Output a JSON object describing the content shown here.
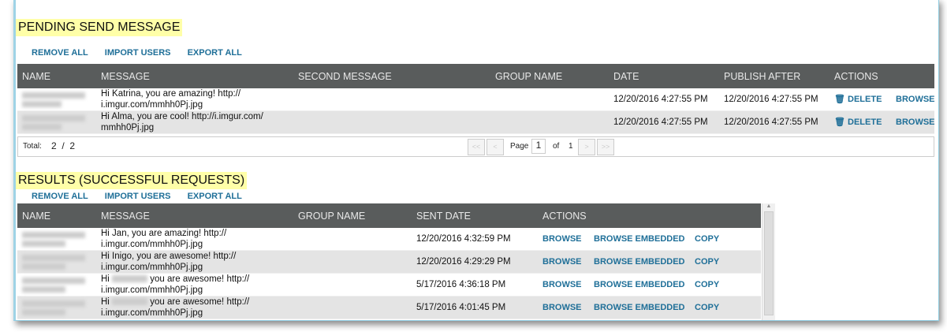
{
  "pending": {
    "title": "PENDING SEND MESSAGE",
    "links": [
      "REMOVE ALL",
      "IMPORT USERS",
      "EXPORT ALL"
    ],
    "headers": [
      "NAME",
      "MESSAGE",
      "SECOND MESSAGE",
      "GROUP NAME",
      "DATE",
      "PUBLISH AFTER",
      "ACTIONS"
    ],
    "rows": [
      {
        "message": "Hi Katrina, you are  amazing!  http:// i.imgur.com/mmhh0Pj.jpg",
        "date": "12/20/2016 4:27:55 PM",
        "publish": "12/20/2016 4:27:55 PM",
        "delete": "DELETE",
        "browse": "BROWSE"
      },
      {
        "message": "Hi Alma, you are cool!   http://i.imgur.com/ mmhh0Pj.jpg",
        "date": "12/20/2016 4:27:55 PM",
        "publish": "12/20/2016 4:27:55 PM",
        "delete": "DELETE",
        "browse": "BROWSE"
      }
    ],
    "pager": {
      "total_label": "Total:",
      "total": "2  /  2",
      "first": "<<",
      "prev": "<",
      "page_label": "Page",
      "page": "1",
      "of_label": "of",
      "pages": "1",
      "next": ">",
      "last": ">>"
    }
  },
  "results": {
    "title": "RESULTS (SUCCESSFUL REQUESTS)",
    "links": [
      "REMOVE ALL",
      "IMPORT USERS",
      "EXPORT ALL"
    ],
    "headers": [
      "NAME",
      "MESSAGE",
      "GROUP NAME",
      "SENT DATE",
      "ACTIONS"
    ],
    "rows": [
      {
        "pre": "Hi Jan, you are  amazing!  http://",
        "post": "i.imgur.com/mmhh0Pj.jpg",
        "date": "12/20/2016 4:32:59 PM"
      },
      {
        "pre": "Hi Inigo, you are  awesome!   http://",
        "post": "i.imgur.com/mmhh0Pj.jpg",
        "date": "12/20/2016 4:29:29 PM"
      },
      {
        "pre": "Hi",
        "mid": "you are  awesome!   http://",
        "post": "i.imgur.com/mmhh0Pj.jpg",
        "date": "5/17/2016 4:36:18 PM"
      },
      {
        "pre": "Hi",
        "mid": "you are  awesome!   http://",
        "post": "i.imgur.com/mmhh0Pj.jpg",
        "date": "5/17/2016 4:01:45 PM"
      }
    ],
    "actions": {
      "browse": "BROWSE",
      "embedded": "BROWSE EMBEDDED",
      "copy": "COPY"
    }
  }
}
